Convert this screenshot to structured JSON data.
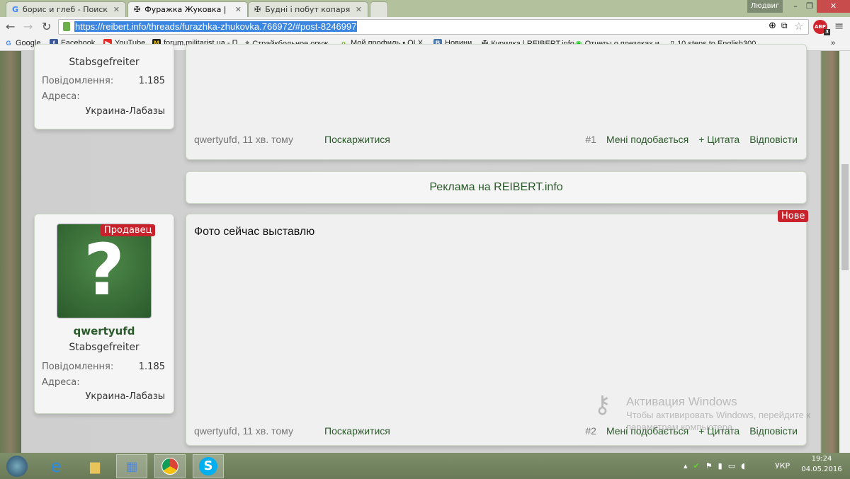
{
  "tabs": [
    {
      "title": "борис и глеб - Поиск в G",
      "icon": "google-icon"
    },
    {
      "title": "Фуражка Жуковка | REIBERT",
      "icon": "iron-cross-icon"
    },
    {
      "title": "Будні і побут копаря| Сто",
      "icon": "iron-cross-icon"
    }
  ],
  "window": {
    "user": "Людвиг"
  },
  "address": {
    "url": "https://reibert.info/threads/furazhka-zhukovka.766972/#post-8246997",
    "abp_count": "3"
  },
  "bookmarks": [
    "Google",
    "Facebook",
    "YouTube",
    "forum.militarist.ua - П",
    "Страйкбольное оруж",
    "Мой профиль • OLX.",
    "Новини",
    "Курилка | REIBERT.info",
    "Отчеты о поездках и",
    "10 steps to English300"
  ],
  "posts": [
    {
      "user": "qwertyufd",
      "rank": "Stabsgefreiter",
      "messages_label": "Повідомлення:",
      "messages": "1.185",
      "address_label": "Адреса:",
      "address": "Украина-Лабазы",
      "author_time": "qwertyufd, 11 хв. тому",
      "report": "Поскаржитися",
      "number": "#1",
      "like": "Мені подобається",
      "quote": "+ Цитата",
      "reply": "Відповісти"
    },
    {
      "user": "qwertyufd",
      "rank": "Stabsgefreiter",
      "seller_badge": "Продавец",
      "new_badge": "Нове",
      "text": "Фото сейчас выставлю",
      "messages_label": "Повідомлення:",
      "messages": "1.185",
      "address_label": "Адреса:",
      "address": "Украина-Лабазы",
      "author_time": "qwertyufd, 11 хв. тому",
      "report": "Поскаржитися",
      "number": "#2",
      "like": "Мені подобається",
      "quote": "+ Цитата",
      "reply": "Відповісти"
    }
  ],
  "ad": "Реклама на REIBERT.info",
  "watermark": {
    "title": "Активация Windows",
    "line1": "Чтобы активировать Windows, перейдите к",
    "line2": "параметрам компьютера."
  },
  "tray": {
    "lang": "УКР",
    "time": "19:24",
    "date": "04.05.2016"
  }
}
